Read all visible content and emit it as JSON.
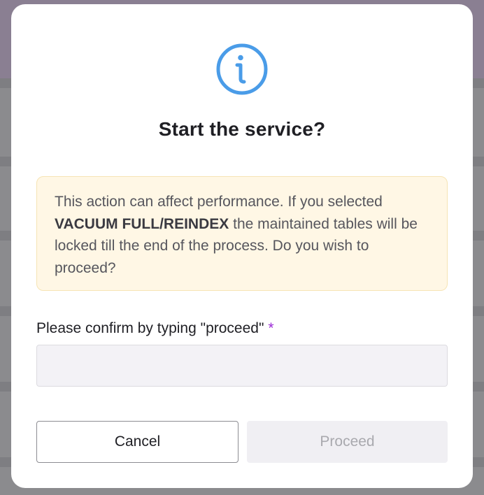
{
  "dialog": {
    "title": "Start the service?",
    "warning": {
      "text_before": "This action can affect performance. If you selected ",
      "bold": "VACUUM FULL/REINDEX",
      "text_after": " the maintained tables will be locked till the end of the process. Do you wish to proceed?"
    },
    "confirm": {
      "label": "Please confirm by typing \"proceed\"",
      "required_marker": "*",
      "value": "",
      "placeholder": ""
    },
    "buttons": {
      "cancel": "Cancel",
      "proceed": "Proceed"
    },
    "icon": "info-icon"
  },
  "colors": {
    "icon_blue": "#4a9ce8",
    "warning_bg": "#fff7e5",
    "required": "#9b2bd6",
    "disabled_text": "#a9a9ae"
  }
}
